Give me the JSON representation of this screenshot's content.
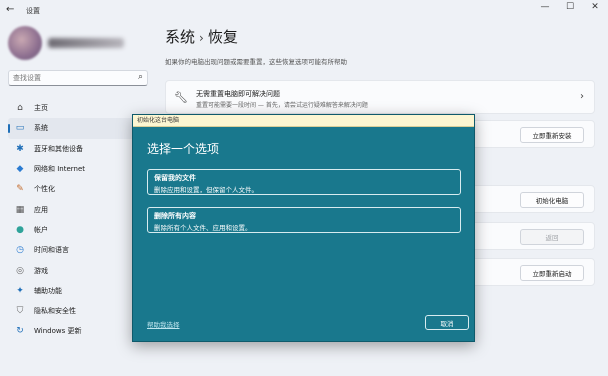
{
  "window": {
    "title": "设置",
    "back_icon": "←",
    "controls": [
      "—",
      "☐",
      "✕"
    ]
  },
  "profile": {
    "avatar": "avatar"
  },
  "search": {
    "placeholder": "查找设置"
  },
  "sidebar": {
    "items": [
      {
        "label": "主页",
        "icon": "home-icon",
        "glyph": "⌂",
        "color": "#444444"
      },
      {
        "label": "系统",
        "icon": "system-icon",
        "glyph": "▭",
        "color": "#1f6fb8",
        "active": true
      },
      {
        "label": "蓝牙和其他设备",
        "icon": "bluetooth-icon",
        "glyph": "✱",
        "color": "#1f6fb8"
      },
      {
        "label": "网络和 Internet",
        "icon": "wifi-icon",
        "glyph": "◆",
        "color": "#2a7bd1"
      },
      {
        "label": "个性化",
        "icon": "brush-icon",
        "glyph": "✎",
        "color": "#c46b2c"
      },
      {
        "label": "应用",
        "icon": "apps-icon",
        "glyph": "▦",
        "color": "#555555"
      },
      {
        "label": "帐户",
        "icon": "account-icon",
        "glyph": "●",
        "color": "#2fa39a"
      },
      {
        "label": "时间和语言",
        "icon": "clock-icon",
        "glyph": "◷",
        "color": "#2a7bd1"
      },
      {
        "label": "游戏",
        "icon": "gamepad-icon",
        "glyph": "◎",
        "color": "#666666"
      },
      {
        "label": "辅助功能",
        "icon": "accessibility-icon",
        "glyph": "✦",
        "color": "#1f6fb8"
      },
      {
        "label": "隐私和安全性",
        "icon": "shield-icon",
        "glyph": "⛉",
        "color": "#666666"
      },
      {
        "label": "Windows 更新",
        "icon": "update-icon",
        "glyph": "↻",
        "color": "#1f6fb8"
      }
    ]
  },
  "main": {
    "breadcrumb_parent": "系统",
    "breadcrumb_sep": "›",
    "breadcrumb_current": "恢复",
    "subtitle": "如果你的电脑出现问题或需要重置，这些恢复选项可能有所帮助",
    "troubleshoot_card": {
      "title": "无需重置电脑即可解决问题",
      "desc": "重置可能需要一段时间 — 首先，请尝试运行疑难解答来解决问题"
    },
    "buttons": {
      "restart_install": "立即重新安装",
      "reset_pc": "初始化电脑",
      "go_back": "返回",
      "restart_now": "立即重新启动"
    }
  },
  "dialog": {
    "title": "初始化这台电脑",
    "heading": "选择一个选项",
    "options": [
      {
        "title": "保留我的文件",
        "desc": "删除应用和设置，但保留个人文件。"
      },
      {
        "title": "删除所有内容",
        "desc": "删除所有个人文件、应用和设置。"
      }
    ],
    "help_link": "帮助我选择",
    "cancel": "取消"
  }
}
